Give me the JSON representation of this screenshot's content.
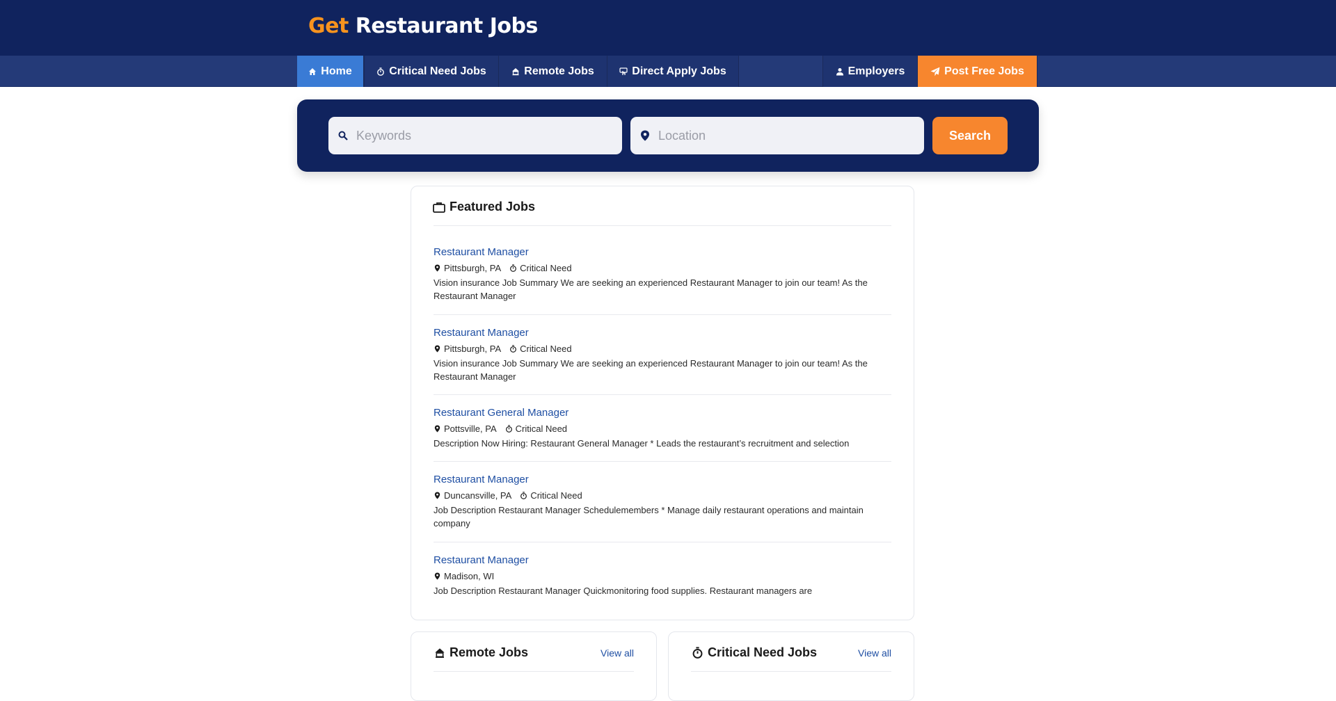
{
  "header": {
    "logo_get": "Get",
    "logo_rest": "Restaurant Jobs"
  },
  "nav": {
    "home": "Home",
    "critical": "Critical Need Jobs",
    "remote": "Remote Jobs",
    "direct": "Direct Apply Jobs",
    "employers": "Employers",
    "post": "Post Free Jobs"
  },
  "search": {
    "keywords_placeholder": "Keywords",
    "location_placeholder": "Location",
    "button": "Search"
  },
  "featured": {
    "title": "Featured Jobs",
    "jobs": [
      {
        "title": "Restaurant Manager",
        "location": "Pittsburgh, PA",
        "tag": "Critical Need",
        "desc": "Vision insurance Job Summary We are seeking an experienced Restaurant Manager to join our team! As the Restaurant Manager"
      },
      {
        "title": "Restaurant Manager",
        "location": "Pittsburgh, PA",
        "tag": "Critical Need",
        "desc": "Vision insurance Job Summary We are seeking an experienced Restaurant Manager to join our team! As the Restaurant Manager"
      },
      {
        "title": "Restaurant General Manager",
        "location": "Pottsville, PA",
        "tag": "Critical Need",
        "desc": "Description Now Hiring: Restaurant General Manager * Leads the restaurant’s recruitment and selection"
      },
      {
        "title": "Restaurant Manager",
        "location": "Duncansville, PA",
        "tag": "Critical Need",
        "desc": "Job Description Restaurant Manager Schedulemembers * Manage daily restaurant operations and maintain company"
      },
      {
        "title": "Restaurant Manager",
        "location": "Madison, WI",
        "desc": "Job Description Restaurant Manager Quickmonitoring food supplies. Restaurant managers are"
      }
    ]
  },
  "remote_section": {
    "title": "Remote Jobs",
    "view_all": "View all"
  },
  "critical_section": {
    "title": "Critical Need Jobs",
    "view_all": "View all"
  },
  "colors": {
    "navy": "#10235e",
    "accent": "#f7862e",
    "link": "#1f4fa3",
    "home_tab": "#3a7bd5"
  }
}
